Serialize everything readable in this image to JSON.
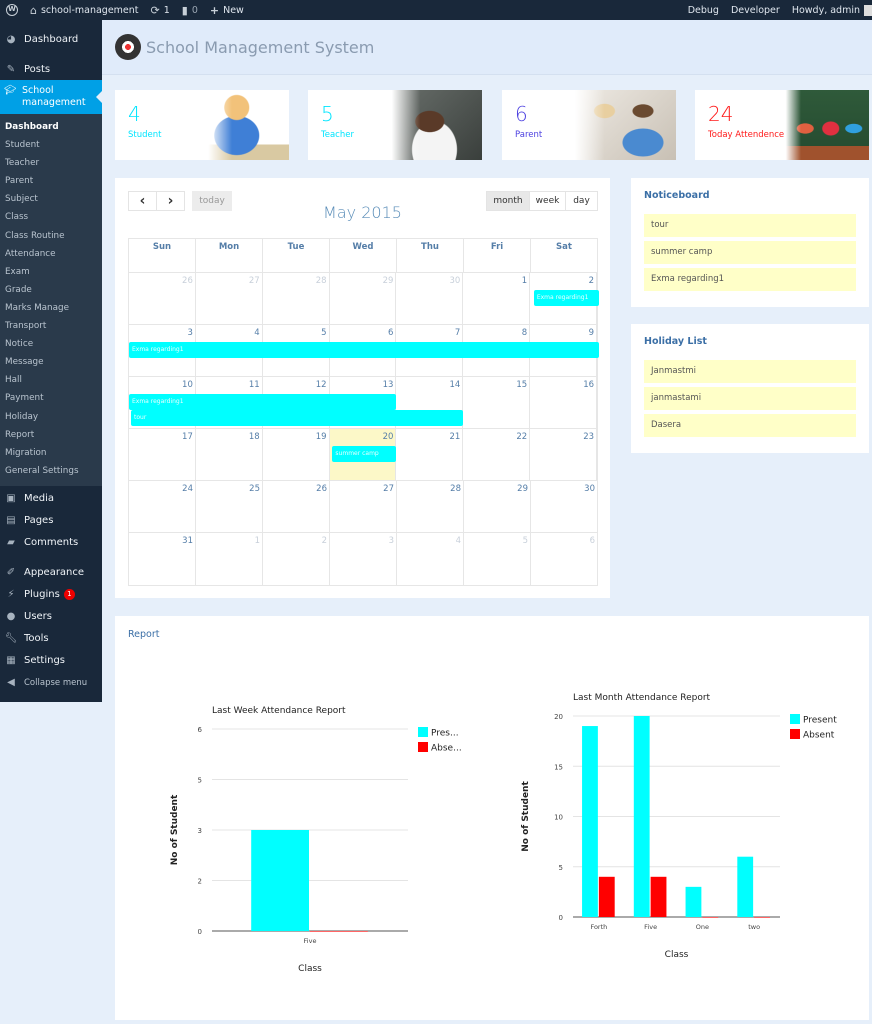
{
  "adminbar": {
    "site_name": "school-management",
    "updates_count": "1",
    "comments_count": "0",
    "new_label": "New",
    "debug_label": "Debug",
    "developer_label": "Developer",
    "howdy_label": "Howdy, admin"
  },
  "sidebar": {
    "top_items": [
      {
        "label": "Dashboard",
        "icon": "dashboard-icon"
      },
      {
        "label": "Posts",
        "icon": "pin-icon"
      }
    ],
    "current": {
      "label": "School management",
      "icon": "graduation-cap-icon"
    },
    "submenu": [
      "Dashboard",
      "Student",
      "Teacher",
      "Parent",
      "Subject",
      "Class",
      "Class Routine",
      "Attendance",
      "Exam",
      "Grade",
      "Marks Manage",
      "Transport",
      "Notice",
      "Message",
      "Hall",
      "Payment",
      "Holiday",
      "Report",
      "Migration",
      "General Settings"
    ],
    "bottom_items": [
      {
        "label": "Media",
        "icon": "media-icon"
      },
      {
        "label": "Pages",
        "icon": "pages-icon"
      },
      {
        "label": "Comments",
        "icon": "comment-icon"
      },
      {
        "label": "Appearance",
        "icon": "paintbrush-icon"
      },
      {
        "label": "Plugins",
        "icon": "plugin-icon",
        "badge": "1"
      },
      {
        "label": "Users",
        "icon": "user-icon"
      },
      {
        "label": "Tools",
        "icon": "wrench-icon"
      },
      {
        "label": "Settings",
        "icon": "settings-icon"
      }
    ],
    "collapse_label": "Collapse menu"
  },
  "header": {
    "title": "School Management System"
  },
  "stats": [
    {
      "value": "4",
      "label": "Student",
      "color": "#00e5ff"
    },
    {
      "value": "5",
      "label": "Teacher",
      "color": "#00e5ff"
    },
    {
      "value": "6",
      "label": "Parent",
      "color": "#4b3fe0"
    },
    {
      "value": "24",
      "label": "Today Attendence",
      "color": "#ff1a1a"
    }
  ],
  "calendar": {
    "prev_label": "‹",
    "next_label": "›",
    "today_label": "today",
    "title": "May 2015",
    "views": [
      "month",
      "week",
      "day"
    ],
    "active_view": "month",
    "weekdays": [
      "Sun",
      "Mon",
      "Tue",
      "Wed",
      "Thu",
      "Fri",
      "Sat"
    ],
    "weeks": [
      [
        [
          "26",
          true
        ],
        [
          "27",
          true
        ],
        [
          "28",
          true
        ],
        [
          "29",
          true
        ],
        [
          "30",
          true
        ],
        [
          "1",
          false
        ],
        [
          "2",
          false
        ]
      ],
      [
        [
          "3",
          false
        ],
        [
          "4",
          false
        ],
        [
          "5",
          false
        ],
        [
          "6",
          false
        ],
        [
          "7",
          false
        ],
        [
          "8",
          false
        ],
        [
          "9",
          false
        ]
      ],
      [
        [
          "10",
          false
        ],
        [
          "11",
          false
        ],
        [
          "12",
          false
        ],
        [
          "13",
          false
        ],
        [
          "14",
          false
        ],
        [
          "15",
          false
        ],
        [
          "16",
          false
        ]
      ],
      [
        [
          "17",
          false
        ],
        [
          "18",
          false
        ],
        [
          "19",
          false
        ],
        [
          "20",
          false
        ],
        [
          "21",
          false
        ],
        [
          "22",
          false
        ],
        [
          "23",
          false
        ]
      ],
      [
        [
          "24",
          false
        ],
        [
          "25",
          false
        ],
        [
          "26",
          false
        ],
        [
          "27",
          false
        ],
        [
          "28",
          false
        ],
        [
          "29",
          false
        ],
        [
          "30",
          false
        ]
      ],
      [
        [
          "31",
          false
        ],
        [
          "1",
          true
        ],
        [
          "2",
          true
        ],
        [
          "3",
          true
        ],
        [
          "4",
          true
        ],
        [
          "5",
          true
        ],
        [
          "6",
          true
        ]
      ]
    ],
    "today_cell": {
      "week": 3,
      "day": 3
    },
    "events": [
      {
        "title": "Exma regarding1",
        "week": 0,
        "start": 6,
        "end": 6,
        "row": 0
      },
      {
        "title": "Exma regarding1",
        "week": 1,
        "start": 0,
        "end": 6,
        "row": 0
      },
      {
        "title": "Exma regarding1",
        "week": 2,
        "start": 0,
        "end": 3,
        "row": 0
      },
      {
        "title": "tour",
        "week": 2,
        "start": 0,
        "end": 4,
        "row": 1
      },
      {
        "title": "summer camp",
        "week": 3,
        "start": 3,
        "end": 3,
        "row": 0
      }
    ],
    "event_color": "#00ffff"
  },
  "noticeboard": {
    "title": "Noticeboard",
    "items": [
      "tour",
      "summer camp",
      "Exma regarding1"
    ]
  },
  "holidays": {
    "title": "Holiday List",
    "items": [
      "Janmastmi",
      "janmastami",
      "Dasera"
    ]
  },
  "report": {
    "title": "Report"
  },
  "chart_data": [
    {
      "type": "bar",
      "title": "Last Week Attendance Report",
      "xlabel": "Class",
      "ylabel": "No of Student",
      "categories": [
        "Five"
      ],
      "series": [
        {
          "name": "Present",
          "legend_label": "Pres...",
          "color": "#00ffff",
          "values": [
            3
          ]
        },
        {
          "name": "Absent",
          "legend_label": "Abse...",
          "color": "#ff0000",
          "values": [
            0
          ]
        }
      ],
      "ylim": [
        0,
        6
      ],
      "ytick_values": [
        0,
        1.5,
        3,
        4.5,
        6
      ],
      "ytick_labels": [
        "0",
        "2",
        "3",
        "5",
        "6"
      ],
      "grid": true,
      "legend": "right"
    },
    {
      "type": "bar",
      "title": "Last Month Attendance Report",
      "xlabel": "Class",
      "ylabel": "No of Student",
      "categories": [
        "Forth",
        "Five",
        "One",
        "two"
      ],
      "series": [
        {
          "name": "Present",
          "legend_label": "Present",
          "color": "#00ffff",
          "values": [
            19,
            20,
            3,
            6
          ]
        },
        {
          "name": "Absent",
          "legend_label": "Absent",
          "color": "#ff0000",
          "values": [
            4,
            4,
            0,
            0
          ]
        }
      ],
      "ylim": [
        0,
        20
      ],
      "ytick_values": [
        0,
        5,
        10,
        15,
        20
      ],
      "ytick_labels": [
        "0",
        "5",
        "10",
        "15",
        "20"
      ],
      "grid": true,
      "legend": "right"
    }
  ]
}
